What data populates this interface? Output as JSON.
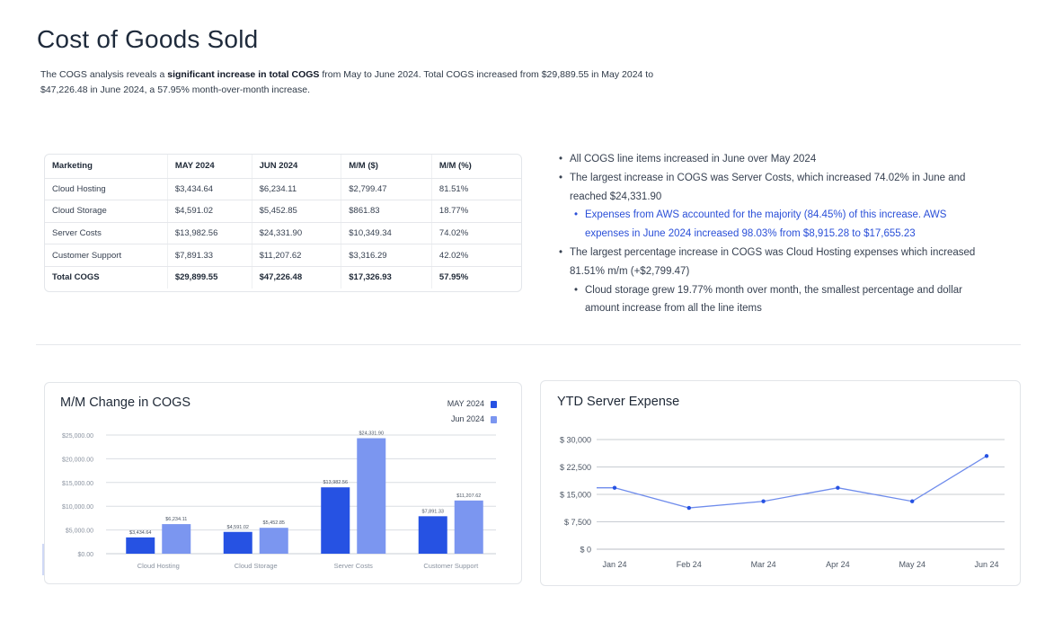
{
  "page": {
    "title": "Cost of Goods Sold",
    "summary_pre": "The COGS analysis reveals a ",
    "summary_bold": "significant increase in total COGS",
    "summary_post": " from May to June 2024. Total COGS increased from $29,889.55 in May 2024 to $47,226.48 in June 2024, a 57.95% month-over-month increase."
  },
  "table": {
    "headers": [
      "Marketing",
      "MAY 2024",
      "JUN 2024",
      "M/M ($)",
      "M/M (%)"
    ],
    "rows": [
      [
        "Cloud Hosting",
        "$3,434.64",
        "$6,234.11",
        "$2,799.47",
        "81.51%"
      ],
      [
        "Cloud Storage",
        "$4,591.02",
        "$5,452.85",
        "$861.83",
        "18.77%"
      ],
      [
        "Server Costs",
        "$13,982.56",
        "$24,331.90",
        "$10,349.34",
        "74.02%"
      ],
      [
        "Customer Support",
        "$7,891.33",
        "$11,207.62",
        "$3,316.29",
        "42.02%"
      ]
    ],
    "total": [
      "Total COGS",
      "$29,899.55",
      "$47,226.48",
      "$17,326.93",
      "57.95%"
    ]
  },
  "bullets": [
    "All COGS line items increased in June over May 2024",
    "The largest increase in COGS was Server Costs, which increased 74.02% in June and reached $24,331.90",
    "Expenses from AWS accounted for the majority (84.45%) of this increase. AWS expenses in June 2024 increased 98.03% from $8,915.28 to $17,655.23",
    "The largest percentage increase in COGS was Cloud Hosting expenses which increased 81.51% m/m (+$2,799.47)",
    "Cloud storage grew 19.77% month over month, the smallest percentage and dollar amount increase from all the line items"
  ],
  "colors": {
    "may": "#2652e3",
    "jun": "#7b96f0",
    "line": "#6f8cec",
    "highlight_text": "#2a4fd8"
  },
  "chart_data": [
    {
      "type": "bar",
      "title": "M/M Change in COGS",
      "categories": [
        "Cloud Hosting",
        "Cloud Storage",
        "Server Costs",
        "Customer Support"
      ],
      "series": [
        {
          "name": "MAY 2024",
          "values": [
            3434.64,
            4591.02,
            13982.56,
            7891.33
          ],
          "labels": [
            "$3,434.64",
            "$4,591.02",
            "$13,982.56",
            "$7,891.33"
          ]
        },
        {
          "name": "Jun 2024",
          "values": [
            6234.11,
            5452.85,
            24331.9,
            11207.62
          ],
          "labels": [
            "$6,234.11",
            "$5,452.85",
            "$24,331.90",
            "$11,207.62"
          ]
        }
      ],
      "ylim": [
        0,
        25000
      ],
      "yticks": [
        "$0.00",
        "$5,000.00",
        "$10,000.00",
        "$15,000.00",
        "$20,000.00",
        "$25,000.00"
      ],
      "grid": true,
      "legend": "top-right"
    },
    {
      "type": "line",
      "title": "YTD Server Expense",
      "categories": [
        "Jan 24",
        "Feb 24",
        "Mar 24",
        "Apr 24",
        "May 24",
        "Jun 24"
      ],
      "values": [
        16800,
        11300,
        13100,
        16800,
        13100,
        25500
      ],
      "ylim": [
        0,
        30000
      ],
      "yticks": [
        "$ 0",
        "$ 7,500",
        "$ 15,000",
        "$ 22,500",
        "$ 30,000"
      ],
      "grid": true
    }
  ]
}
